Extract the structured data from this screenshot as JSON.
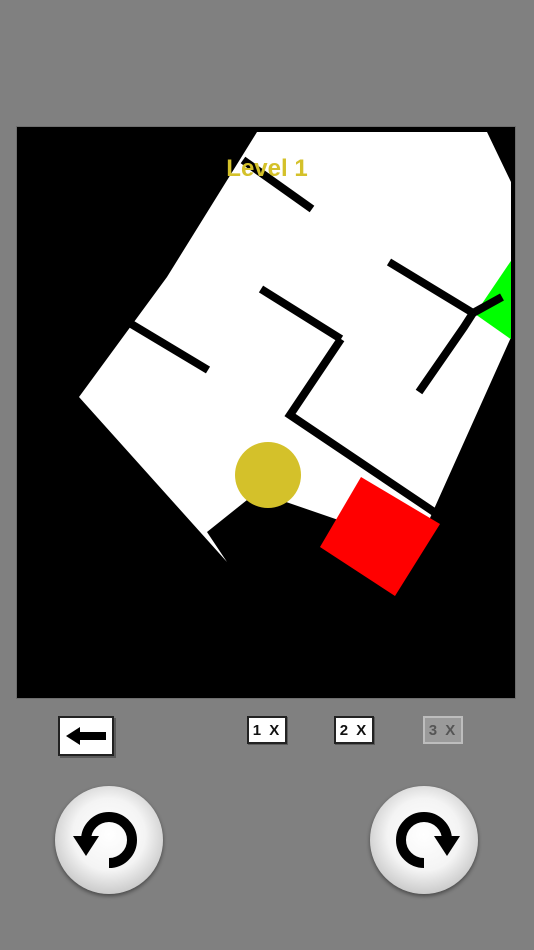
{
  "level": {
    "label": "Level 1"
  },
  "controls": {
    "back_icon": "left-arrow-icon",
    "speed_options": [
      {
        "label": "1 X",
        "enabled": true
      },
      {
        "label": "2 X",
        "enabled": true
      },
      {
        "label": "3 X",
        "enabled": false
      }
    ],
    "rotate_left_icon": "rotate-counterclockwise-icon",
    "rotate_right_icon": "rotate-clockwise-icon"
  },
  "colors": {
    "background": "#808080",
    "board": "#000000",
    "maze_floor": "#ffffff",
    "maze_wall": "#000000",
    "ball": "#d4c12a",
    "start_tile": "#ff0000",
    "goal_tile": "#00ff00",
    "level_text": "#d4c12a"
  }
}
